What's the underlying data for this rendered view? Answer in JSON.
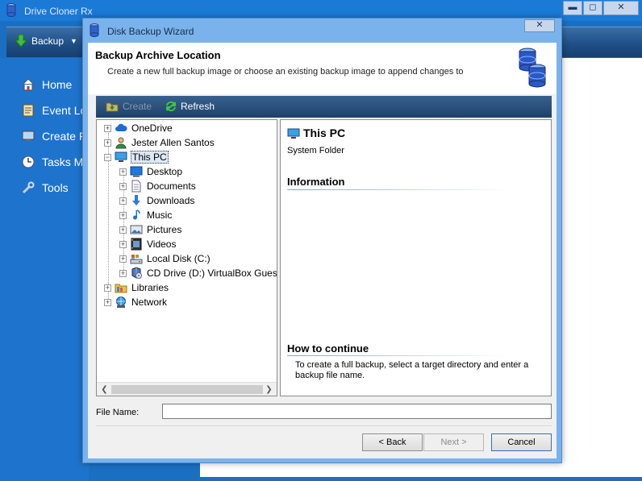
{
  "app": {
    "title": "Drive Cloner Rx",
    "controls": {
      "minimize": "▬",
      "maximize": "◻",
      "close": "✕"
    },
    "toolbar": {
      "backup_label": "Backup"
    },
    "nav": [
      {
        "label": "Home",
        "icon": "home-icon"
      },
      {
        "label": "Event Lo",
        "icon": "event-log-icon"
      },
      {
        "label": "Create F",
        "icon": "monitor-icon"
      },
      {
        "label": "Tasks M",
        "icon": "clock-icon"
      },
      {
        "label": "Tools",
        "icon": "tools-icon"
      }
    ],
    "colors": {
      "sidebar": "#1e74cc",
      "titlebar": "#1a7ad6",
      "toolbar": "#1e4d84"
    }
  },
  "dialog": {
    "title": "Disk Backup Wizard",
    "close": "✕",
    "header": {
      "title": "Backup Archive Location",
      "description": "Create a new full backup image or choose an existing backup image to append changes to"
    },
    "toolbar": {
      "create": "Create",
      "refresh": "Refresh"
    },
    "tree": [
      {
        "label": "OneDrive",
        "icon": "cloud-icon",
        "expander": "+"
      },
      {
        "label": "Jester Allen Santos",
        "icon": "user-icon",
        "expander": "+"
      },
      {
        "label": "This PC",
        "icon": "computer-icon",
        "expander": "−",
        "selected": true
      },
      {
        "label": "Desktop",
        "icon": "desktop-icon",
        "expander": "+"
      },
      {
        "label": "Documents",
        "icon": "document-icon",
        "expander": "+"
      },
      {
        "label": "Downloads",
        "icon": "download-icon",
        "expander": "+"
      },
      {
        "label": "Music",
        "icon": "music-icon",
        "expander": "+"
      },
      {
        "label": "Pictures",
        "icon": "pictures-icon",
        "expander": "+"
      },
      {
        "label": "Videos",
        "icon": "videos-icon",
        "expander": "+"
      },
      {
        "label": "Local Disk (C:)",
        "icon": "local-disk-icon",
        "expander": "+"
      },
      {
        "label": "CD Drive (D:) VirtualBox Guest",
        "icon": "cd-drive-icon",
        "expander": "+"
      },
      {
        "label": "Libraries",
        "icon": "libraries-icon",
        "expander": "+"
      },
      {
        "label": "Network",
        "icon": "network-icon",
        "expander": "+"
      }
    ],
    "info": {
      "title": "This PC",
      "subtitle": "System Folder",
      "information_heading": "Information",
      "how_heading": "How to continue",
      "how_text": "To create a full backup, select a target directory and enter a backup file name."
    },
    "file_name": {
      "label": "File Name:",
      "value": ""
    },
    "buttons": {
      "back": "< Back",
      "next": "Next >",
      "cancel": "Cancel"
    }
  }
}
